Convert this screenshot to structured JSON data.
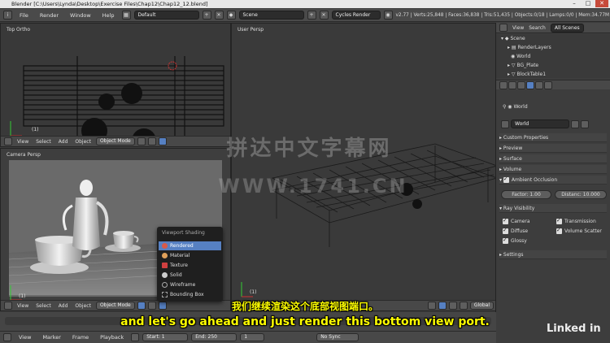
{
  "window": {
    "title": "Blender [C:\\Users\\Lynda\\Desktop\\Exercise Files\\Chap12\\Chap12_12.blend]"
  },
  "info_header": {
    "menus": [
      "File",
      "Render",
      "Window",
      "Help"
    ],
    "screen_layout": "Default",
    "scene": "Scene",
    "render_engine": "Cycles Render",
    "stats": "v2.77 | Verts:25,848 | Faces:36,838 | Tris:51,435 | Objects:0/18 | Lamps:0/0 | Mem:34.77M"
  },
  "viewports": {
    "top_ortho": {
      "label": "Top Ortho",
      "frame": "(1)"
    },
    "user_persp": {
      "label": "User Persp",
      "frame": "(1)"
    },
    "camera_persp": {
      "label": "Camera Persp",
      "frame": "(1)"
    }
  },
  "viewport_header": {
    "menus": [
      "View",
      "Select",
      "Add",
      "Object"
    ],
    "mode": "Object Mode",
    "pivot": "Global"
  },
  "shading_menu": {
    "title": "Viewport Shading",
    "items": [
      {
        "label": "Rendered",
        "icon": "rendered-icon",
        "color": "#d85a4a"
      },
      {
        "label": "Material",
        "icon": "material-icon",
        "color": "#e0a05a"
      },
      {
        "label": "Texture",
        "icon": "texture-icon",
        "color": "#d04040"
      },
      {
        "label": "Solid",
        "icon": "solid-icon",
        "color": "#cccccc"
      },
      {
        "label": "Wireframe",
        "icon": "wireframe-icon",
        "color": "#aaaaaa"
      },
      {
        "label": "Bounding Box",
        "icon": "bounding-box-icon",
        "color": "#aaaaaa"
      }
    ],
    "active": "Rendered"
  },
  "outliner": {
    "tabs": [
      "View",
      "Search",
      "All Scenes"
    ],
    "items": [
      "Scene",
      "RenderLayers",
      "World",
      "BG_Plate",
      "BlockTable1"
    ]
  },
  "properties": {
    "context": "World",
    "world_name": "World",
    "panels": [
      "Custom Properties",
      "Preview",
      "Surface",
      "Volume"
    ],
    "ambient_occlusion": {
      "label": "Ambient Occlusion",
      "factor_label": "Factor:",
      "factor_value": "1.00",
      "distance_label": "Distanc:",
      "distance_value": "10.000"
    },
    "ray_visibility": {
      "label": "Ray Visibility",
      "left": [
        "Camera",
        "Diffuse",
        "Glossy"
      ],
      "right": [
        "Transmission",
        "Volume Scatter"
      ]
    },
    "settings": "Settings"
  },
  "timeline": {
    "menus": [
      "View",
      "Marker",
      "Frame",
      "Playback"
    ],
    "start_label": "Start:",
    "start_value": "1",
    "end_label": "End:",
    "end_value": "250",
    "current": "1",
    "sync": "No Sync"
  },
  "subtitles": {
    "chinese": "我们继续渲染这个底部视图端口。",
    "english": "and let's go ahead and just render this bottom view port."
  },
  "watermark": {
    "line1": "拼达中文字幕网",
    "line2": "WWW.1741.CN"
  },
  "brand": "Linked in"
}
